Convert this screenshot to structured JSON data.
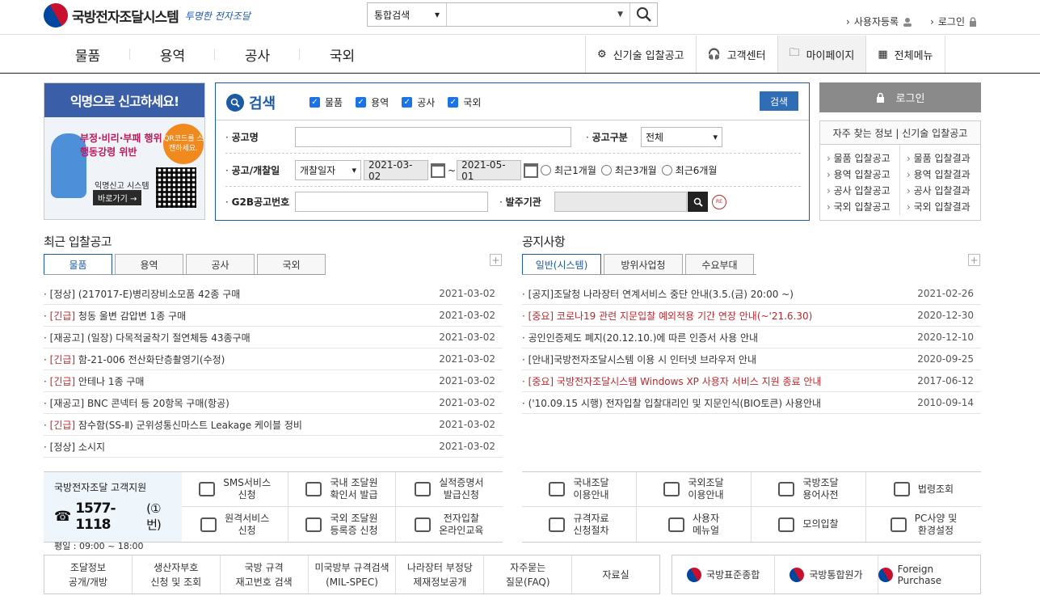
{
  "header": {
    "logo_title": "국방전자조달시스템",
    "slogan": "투명한 전자조달",
    "search_scope": "통합검색",
    "search_value": "",
    "util": {
      "register": "사용자등록",
      "login": "로그인"
    }
  },
  "gnb": {
    "menu": [
      "물품",
      "용역",
      "공사",
      "국외"
    ],
    "quick": [
      "신기술 입찰공고",
      "고객센터",
      "마이페이지",
      "전체메뉴"
    ]
  },
  "banner": {
    "title": "익명으로 신고하세요!",
    "line1": "부정·비리·부패 행위",
    "line2": "행동강령 위반",
    "qr_text": "QR코드를 스캔하세요.",
    "system": "익명신고 시스템",
    "go": "바로가기 →"
  },
  "search": {
    "title": "검색",
    "checks": [
      "물품",
      "용역",
      "공사",
      "국외"
    ],
    "button": "검색",
    "label_name": "공고명",
    "name_value": "",
    "label_type": "공고구분",
    "type_value": "전체",
    "label_date": "공고/개찰일",
    "date_type": "개찰일자",
    "date_from": "2021-03-02",
    "date_sep": "~",
    "date_to": "2021-05-01",
    "radios": [
      "최근1개월",
      "최근3개월",
      "최근6개월"
    ],
    "label_g2b": "G2B공고번호",
    "g2b_value": "",
    "label_org": "발주기관",
    "org_value": "",
    "reset": "RE"
  },
  "login": {
    "button": "로그인",
    "quick_head": "자주 찾는 정보 | 신기술 입찰공고",
    "col1": [
      "물품 입찰공고",
      "용역 입찰공고",
      "공사 입찰공고",
      "국외 입찰공고"
    ],
    "col2": [
      "물품 입찰결과",
      "용역 입찰결과",
      "공사 입찰결과",
      "국외 입찰결과"
    ]
  },
  "bids": {
    "title": "최근 입찰공고",
    "tabs": [
      "물품",
      "용역",
      "공사",
      "국외"
    ],
    "more": "+",
    "items": [
      {
        "prefix": "",
        "text": "[정상] (217017-E)병리장비소모품 42종 구매",
        "date": "2021-03-02"
      },
      {
        "prefix": "[긴급]",
        "text": " 청동 울변 감압변 1종 구매",
        "date": "2021-03-02"
      },
      {
        "prefix": "",
        "text": "[재공고] (일장) 다목적굴착기 절연체등 43종구매",
        "date": "2021-03-02"
      },
      {
        "prefix": "[긴급]",
        "text": " 함-21-006 전산화단층촬영기(수정)",
        "date": "2021-03-02"
      },
      {
        "prefix": "[긴급]",
        "text": " 안테나 1종 구매",
        "date": "2021-03-02"
      },
      {
        "prefix": "",
        "text": "[재공고] BNC 콘넥터 등 20항목 구매(항공)",
        "date": "2021-03-02"
      },
      {
        "prefix": "[긴급]",
        "text": " 잠수함(SS-Ⅱ) 군위성통신마스트 Leakage 케이블 정비",
        "date": "2021-03-02"
      },
      {
        "prefix": "",
        "text": "[정상] 소시지",
        "date": "2021-03-02"
      }
    ]
  },
  "notices": {
    "title": "공지사항",
    "tabs": [
      "일반(시스템)",
      "방위사업청",
      "수요부대"
    ],
    "more": "+",
    "items": [
      {
        "text": "[공지]조달청 나라장터 연계서비스 중단 안내(3.5.(금) 20:00 ~)",
        "date": "2021-02-26",
        "red": false
      },
      {
        "text": "[중요] 코로나19 관련 지문입찰 예외적용 기간 연장 안내(~'21.6.30)",
        "date": "2020-12-30",
        "red": true
      },
      {
        "text": "공인인증제도 폐지(20.12.10.)에 따른 인증서 사용 안내",
        "date": "2020-12-10",
        "red": false
      },
      {
        "text": "[안내]국방전자조달시스템 이용 시 인터넷 브라우저 안내",
        "date": "2020-09-25",
        "red": false
      },
      {
        "text": "[중요] 국방전자조달시스템 Windows XP 사용자 서비스 지원 종료 안내",
        "date": "2017-06-12",
        "red": true
      },
      {
        "text": "('10.09.15 시행) 전자입찰 입찰대리인 및 지문인식(BIO토큰) 사용안내",
        "date": "2010-09-14",
        "red": false
      }
    ]
  },
  "support": {
    "title": "국방전자조달 고객지원",
    "phone": "1577-1118",
    "ext": "(①번)",
    "hours": "평일 : 09:00 ~ 18:00",
    "services": [
      [
        "SMS서비스",
        "신청"
      ],
      [
        "국내 조달원",
        "확인서 발급"
      ],
      [
        "실적증명서",
        "발급신청"
      ],
      [
        "원격서비스",
        "신청"
      ],
      [
        "국외 조달원",
        "등록증 신청"
      ],
      [
        "전자입찰",
        "온라인교육"
      ]
    ]
  },
  "guides": [
    [
      "국내조달",
      "이용안내"
    ],
    [
      "국외조달",
      "이용안내"
    ],
    [
      "국방조달",
      "용어사전"
    ],
    [
      "법령조회",
      ""
    ],
    [
      "규격자료",
      "신청절차"
    ],
    [
      "사용자",
      "메뉴얼"
    ],
    [
      "모의입찰",
      ""
    ],
    [
      "PC사양 및",
      "환경설정"
    ]
  ],
  "linkbar": [
    [
      "조달정보",
      "공개/개방"
    ],
    [
      "생산자부호",
      "신청 및 조회"
    ],
    [
      "국방 규격",
      "재고번호 검색"
    ],
    [
      "미국방부 규격검색",
      "(MIL-SPEC)"
    ],
    [
      "나라장터 부정당",
      "제재정보공개"
    ],
    [
      "자주묻는",
      "질문(FAQ)"
    ],
    [
      "자료실",
      ""
    ]
  ],
  "sites": [
    "국방표준종합",
    "국방통합원가",
    "Foreign Purchase"
  ],
  "colors": {
    "primary": "#1d5aa6",
    "urgent": "#c0272d",
    "login_bg": "#8a8a8a"
  }
}
